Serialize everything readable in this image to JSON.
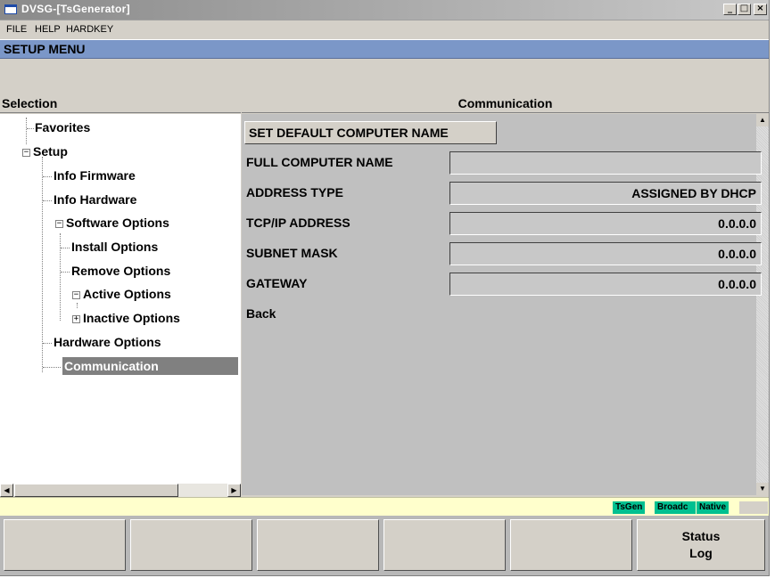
{
  "window": {
    "title": "DVSG-[TsGenerator]"
  },
  "menubar": {
    "items": [
      "FILE",
      "HELP",
      "HARDKEY"
    ]
  },
  "header": {
    "title": "SETUP MENU"
  },
  "selection_panel": {
    "title": "Selection",
    "tree": [
      {
        "label": "Favorites"
      },
      {
        "label": "Setup",
        "expanded": true
      },
      {
        "label": "Info Firmware"
      },
      {
        "label": "Info Hardware"
      },
      {
        "label": "Software Options",
        "expanded": true
      },
      {
        "label": "Install Options"
      },
      {
        "label": "Remove Options"
      },
      {
        "label": "Active Options",
        "expanded": true
      },
      {
        "label": "Inactive Options",
        "expanded": false
      },
      {
        "label": "Hardware Options"
      },
      {
        "label": "Communication",
        "selected": true
      }
    ]
  },
  "communication": {
    "title": "Communication",
    "default_button": "SET DEFAULT COMPUTER NAME",
    "fields": [
      {
        "label": "FULL COMPUTER NAME",
        "value": ""
      },
      {
        "label": "ADDRESS TYPE",
        "value": "ASSIGNED BY DHCP"
      },
      {
        "label": "TCP/IP ADDRESS",
        "value": "0.0.0.0"
      },
      {
        "label": "SUBNET MASK",
        "value": "0.0.0.0"
      },
      {
        "label": "GATEWAY",
        "value": "0.0.0.0"
      }
    ],
    "back_label": "Back"
  },
  "statusbar": {
    "tags": [
      "TsGen",
      "Broadc",
      "Native"
    ],
    "tag_color": "#00c090"
  },
  "softkeys": [
    "",
    "",
    "",
    "",
    "",
    "Status\nLog"
  ],
  "colors": {
    "header_bg": "#7b97c8",
    "selected_bg": "#808080",
    "statusbar_bg": "#ffffcc"
  },
  "icons": {
    "app": "window-icon",
    "minimize": "minimize-icon",
    "maximize": "maximize-icon",
    "close": "close-icon",
    "expand_plus": "plus-box-icon",
    "collapse_minus": "minus-box-icon"
  }
}
